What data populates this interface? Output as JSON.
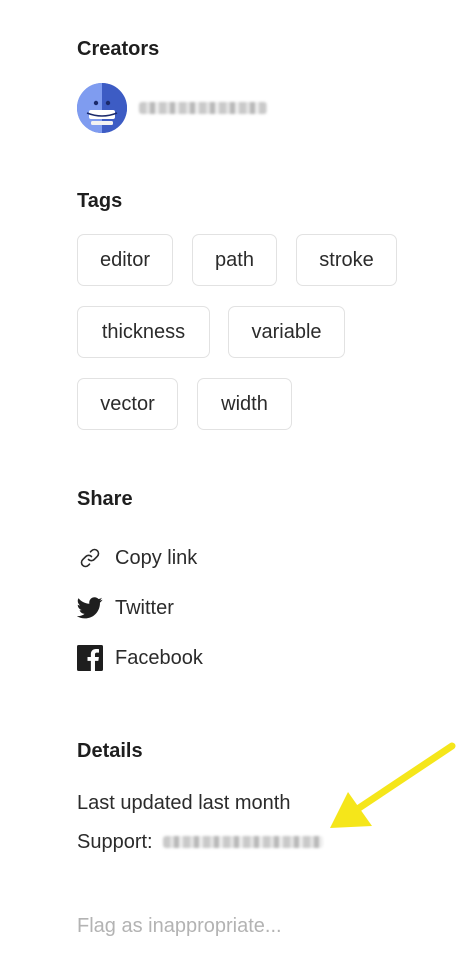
{
  "creators": {
    "title": "Creators",
    "name_redacted": true
  },
  "tags": {
    "title": "Tags",
    "items": [
      "editor",
      "path",
      "stroke",
      "thickness",
      "variable",
      "vector",
      "width"
    ]
  },
  "share": {
    "title": "Share",
    "items": [
      {
        "label": "Copy link",
        "icon": "link-icon"
      },
      {
        "label": "Twitter",
        "icon": "twitter-icon"
      },
      {
        "label": "Facebook",
        "icon": "facebook-icon"
      }
    ]
  },
  "details": {
    "title": "Details",
    "last_updated": "Last updated last month",
    "support_label": "Support:",
    "support_value_redacted": true
  },
  "flag": {
    "label": "Flag as inappropriate..."
  },
  "colors": {
    "arrow": "#f5e61a",
    "tag_border": "#e2e2e2",
    "muted_text": "#b3b3b3",
    "avatar_blue": "#4b6fd8"
  }
}
